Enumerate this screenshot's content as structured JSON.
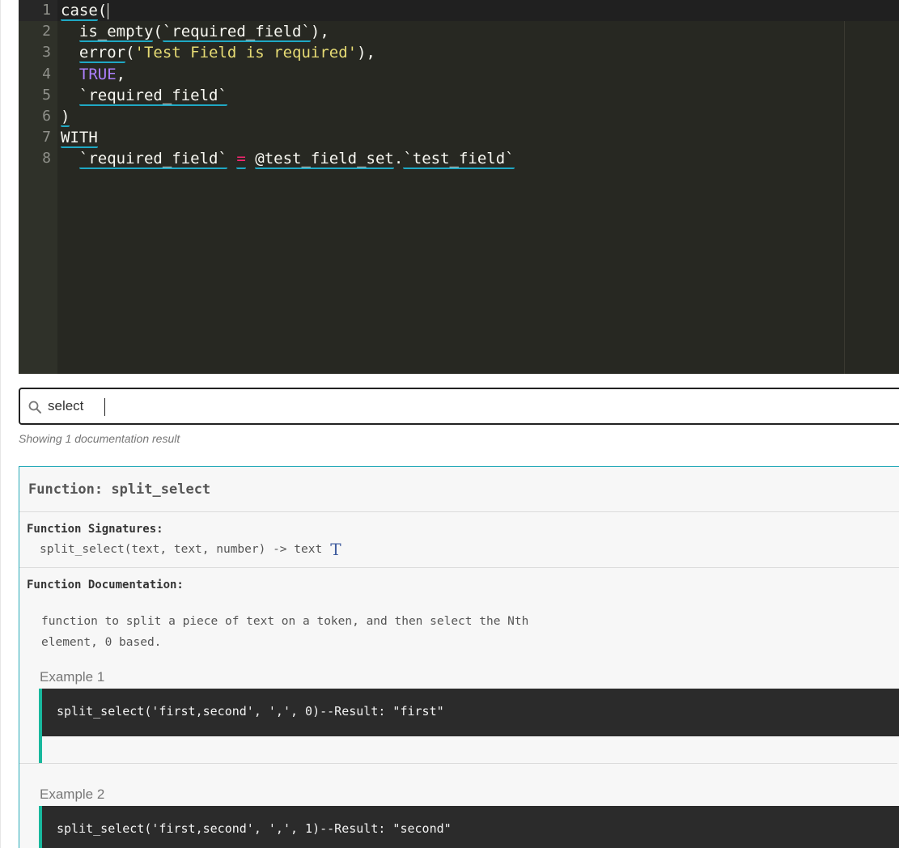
{
  "editor": {
    "line_numbers": [
      "1",
      "2",
      "3",
      "4",
      "5",
      "6",
      "7",
      "8"
    ]
  },
  "search": {
    "value": "select",
    "result_count": "Showing 1 documentation result"
  },
  "doc": {
    "title": "Function: split_select",
    "signatures_label": "Function Signatures:",
    "signature": "split_select(text, text, number) -> text",
    "return_type_icon": "T",
    "documentation_label": "Function Documentation:",
    "description": "function to split a piece of text on a token, and then select the Nth element, 0 based.",
    "examples": [
      {
        "label": "Example 1",
        "code": "split_select('first,second', ',', 0)--Result: \"first\""
      },
      {
        "label": "Example 2",
        "code": "split_select('first,second', ',', 1)--Result: \"second\""
      }
    ]
  },
  "colors": {
    "editor_bg": "#272822",
    "keyword": "#ae81ff",
    "string": "#e6db74",
    "operator": "#f92672",
    "underline": "#1fa8c4",
    "doc_border": "#27aab9",
    "example_accent": "#18b89d"
  }
}
